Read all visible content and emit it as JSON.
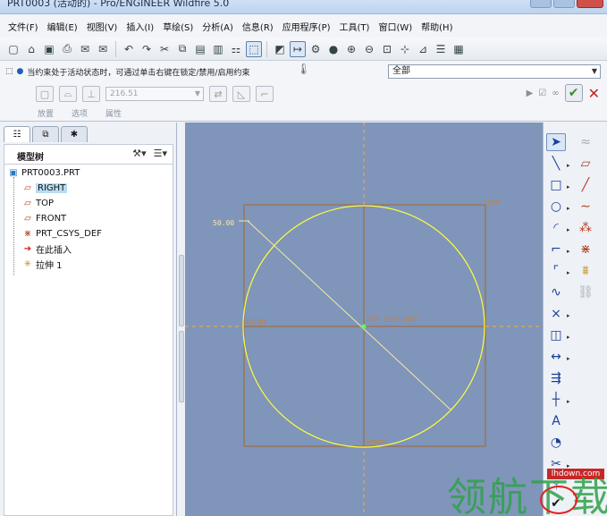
{
  "window": {
    "title": "PRT0003 (活动的) - Pro/ENGINEER Wildfire 5.0"
  },
  "menu": [
    "文件(F)",
    "编辑(E)",
    "视图(V)",
    "插入(I)",
    "草绘(S)",
    "分析(A)",
    "信息(R)",
    "应用程序(P)",
    "工具(T)",
    "窗口(W)",
    "帮助(H)"
  ],
  "toolbar": {
    "icons": [
      "new-icon",
      "open-icon",
      "save-icon",
      "print-icon",
      "email-icon",
      "email-link-icon",
      "undo-icon",
      "redo-icon",
      "cut-icon",
      "copy-icon",
      "paste-icon",
      "paste-special-icon",
      "regenerate-icon",
      "select-box-icon",
      "sketch-view-icon",
      "dimension-toggle-icon",
      "constraint-toggle-icon",
      "shading-icon",
      "zoom-in-icon",
      "zoom-out-icon",
      "refit-icon",
      "grid-icon",
      "vertex-icon",
      "layers-icon",
      "hidden-line-icon"
    ]
  },
  "dashboard": {
    "status_message": "当约束处于活动状态时，可通过单击右键在锁定/禁用/启用约束",
    "filter_value": "全部",
    "depth_value": "216.51",
    "tabs": [
      "放置",
      "选项",
      "属性"
    ]
  },
  "model_tree": {
    "nav_tabs": [
      "model-tree-tab-icon",
      "layers-tab-icon",
      "favorites-tab-icon"
    ],
    "header": "模型树",
    "items": [
      {
        "label": "PRT0003.PRT",
        "icon": "part-icon",
        "selected": false
      },
      {
        "label": "RIGHT",
        "icon": "datum-plane-icon",
        "selected": true
      },
      {
        "label": "TOP",
        "icon": "datum-plane-icon",
        "selected": false
      },
      {
        "label": "FRONT",
        "icon": "datum-plane-icon",
        "selected": false
      },
      {
        "label": "PRT_CSYS_DEF",
        "icon": "csys-icon",
        "selected": false
      },
      {
        "label": "在此插入",
        "icon": "insert-here-icon",
        "selected": false
      },
      {
        "label": "拉伸 1",
        "icon": "extrude-icon",
        "selected": false
      }
    ]
  },
  "sketch": {
    "dimension_label": "50.00",
    "plane_labels": {
      "top": "TOP",
      "front": "FRONT",
      "csys": "PRT_CSYS_DEF",
      "right": "RIGHT"
    },
    "colors": {
      "background": "#7f95b9",
      "circle": "#ffff3c",
      "datum": "#ff9a2e",
      "frame": "#b06a2a",
      "dimension": "#f5e9a8"
    }
  },
  "sketch_tools": {
    "icons": [
      "select-arrow-icon",
      "line-icon",
      "rectangle-icon",
      "circle-icon",
      "arc-icon",
      "fillet-icon",
      "spline-icon",
      "point-icon",
      "use-edge-icon",
      "dimension-icon",
      "modify-icon",
      "constraint-icon",
      "text-icon",
      "palette-icon",
      "trim-icon",
      "mirror-icon",
      "done-check-icon"
    ]
  },
  "watermark": {
    "site": "lhdown.com",
    "brand": "领航下载"
  }
}
